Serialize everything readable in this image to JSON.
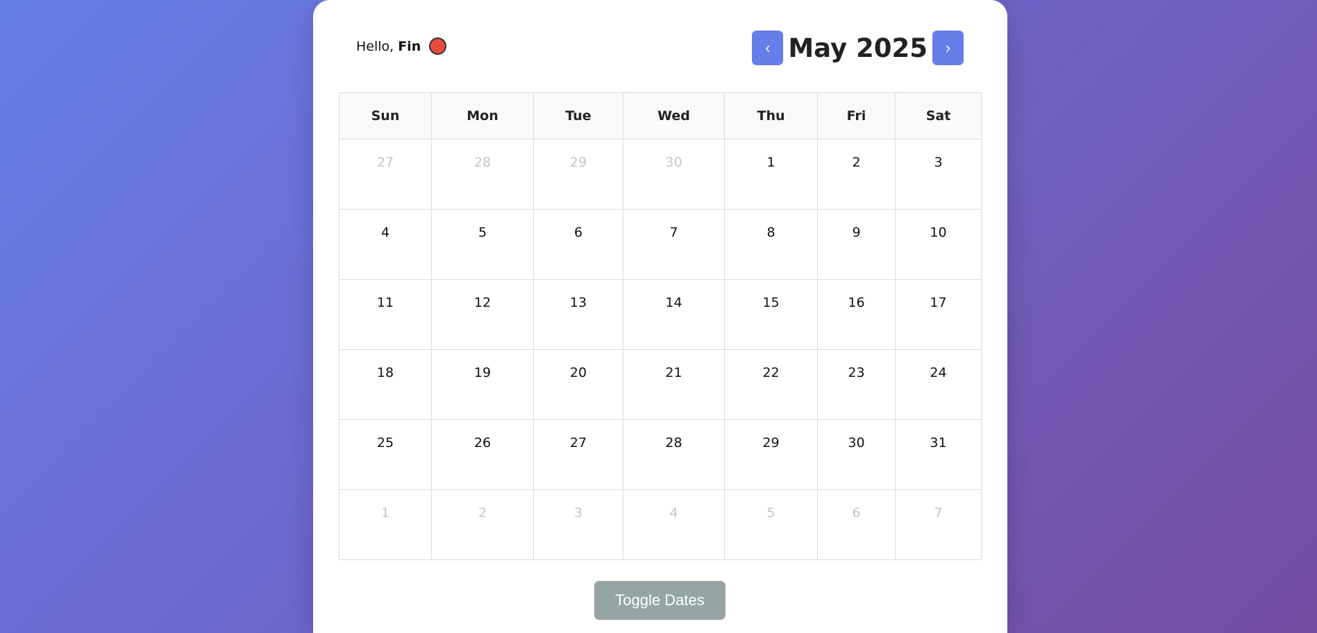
{
  "greeting": {
    "prefix": "Hello,",
    "name": "Fin",
    "status_color": "#e74c3c"
  },
  "nav": {
    "prev_label": "‹",
    "next_label": "›",
    "month_title": "May 2025"
  },
  "calendar": {
    "weekdays": [
      "Sun",
      "Mon",
      "Tue",
      "Wed",
      "Thu",
      "Fri",
      "Sat"
    ],
    "weeks": [
      [
        {
          "day": "27",
          "other": true
        },
        {
          "day": "28",
          "other": true
        },
        {
          "day": "29",
          "other": true
        },
        {
          "day": "30",
          "other": true
        },
        {
          "day": "1",
          "other": false
        },
        {
          "day": "2",
          "other": false
        },
        {
          "day": "3",
          "other": false
        }
      ],
      [
        {
          "day": "4",
          "other": false
        },
        {
          "day": "5",
          "other": false
        },
        {
          "day": "6",
          "other": false
        },
        {
          "day": "7",
          "other": false
        },
        {
          "day": "8",
          "other": false
        },
        {
          "day": "9",
          "other": false
        },
        {
          "day": "10",
          "other": false
        }
      ],
      [
        {
          "day": "11",
          "other": false
        },
        {
          "day": "12",
          "other": false
        },
        {
          "day": "13",
          "other": false
        },
        {
          "day": "14",
          "other": false
        },
        {
          "day": "15",
          "other": false
        },
        {
          "day": "16",
          "other": false
        },
        {
          "day": "17",
          "other": false
        }
      ],
      [
        {
          "day": "18",
          "other": false
        },
        {
          "day": "19",
          "other": false
        },
        {
          "day": "20",
          "other": false
        },
        {
          "day": "21",
          "other": false
        },
        {
          "day": "22",
          "other": false
        },
        {
          "day": "23",
          "other": false
        },
        {
          "day": "24",
          "other": false
        }
      ],
      [
        {
          "day": "25",
          "other": false
        },
        {
          "day": "26",
          "other": false
        },
        {
          "day": "27",
          "other": false
        },
        {
          "day": "28",
          "other": false
        },
        {
          "day": "29",
          "other": false
        },
        {
          "day": "30",
          "other": false
        },
        {
          "day": "31",
          "other": false
        }
      ],
      [
        {
          "day": "1",
          "other": true
        },
        {
          "day": "2",
          "other": true
        },
        {
          "day": "3",
          "other": true
        },
        {
          "day": "4",
          "other": true
        },
        {
          "day": "5",
          "other": true
        },
        {
          "day": "6",
          "other": true
        },
        {
          "day": "7",
          "other": true
        }
      ]
    ]
  },
  "actions": {
    "toggle_label": "Toggle Dates"
  },
  "colors": {
    "accent": "#667eea",
    "toggle": "#95a5a6",
    "other_month_text": "#c4c4c4"
  }
}
